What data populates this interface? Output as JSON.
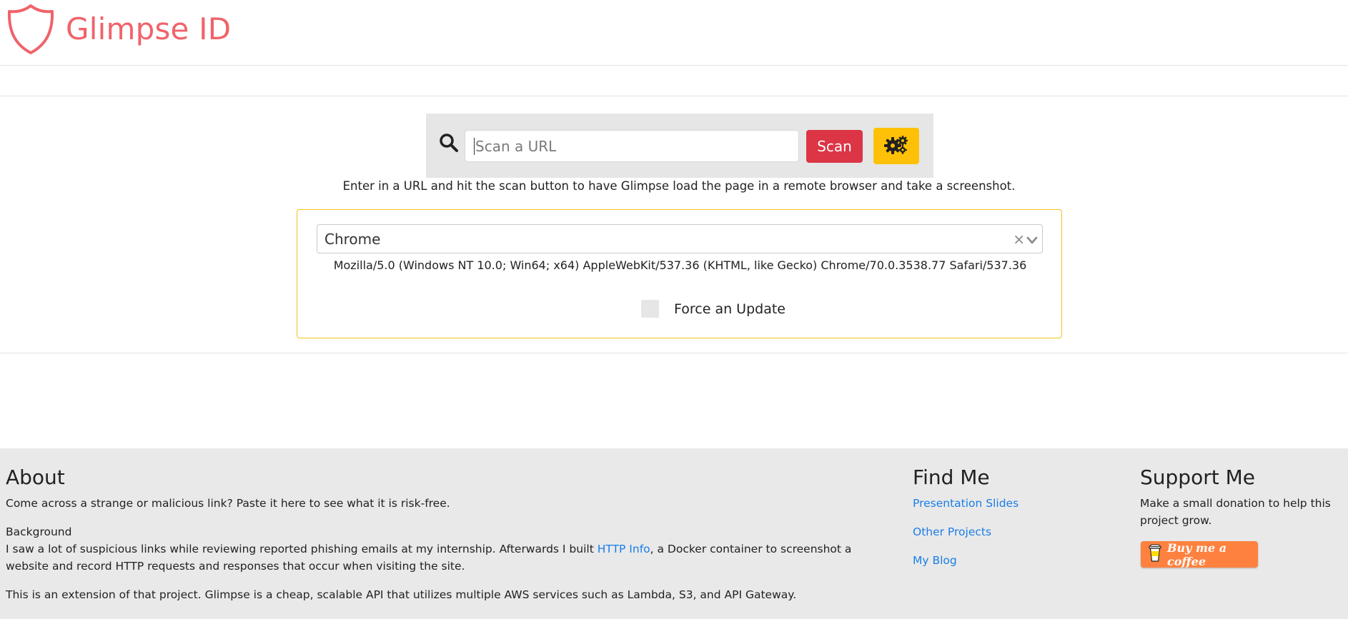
{
  "brand": {
    "name": "Glimpse ID",
    "color": "#f0636a"
  },
  "search": {
    "placeholder": "Scan a URL",
    "scan_label": "Scan",
    "helper": "Enter in a URL and hit the scan button to have Glimpse load the page in a remote browser and take a screenshot."
  },
  "options": {
    "browser_selected": "Chrome",
    "clear_symbol": "×",
    "user_agent": "Mozilla/5.0 (Windows NT 10.0; Win64; x64) AppleWebKit/537.36 (KHTML, like Gecko) Chrome/70.0.3538.77 Safari/537.36",
    "force_update_label": "Force an Update",
    "force_update_checked": false
  },
  "footer": {
    "about": {
      "title": "About",
      "intro": "Come across a strange or malicious link? Paste it here to see what it is risk-free.",
      "background_heading": "Background",
      "background_pre": "I saw a lot of suspicious links while reviewing reported phishing emails at my internship. Afterwards I built ",
      "background_link": "HTTP Info",
      "background_post": ", a Docker container to screenshot a website and record HTTP requests and responses that occur when visiting the site.",
      "extension": "This is an extension of that project. Glimpse is a cheap, scalable API that utilizes multiple AWS services such as Lambda, S3, and API Gateway."
    },
    "find_me": {
      "title": "Find Me",
      "links": [
        "Presentation Slides",
        "Other Projects",
        "My Blog"
      ]
    },
    "support": {
      "title": "Support Me",
      "text": "Make a small donation to help this project grow.",
      "button": "Buy me a coffee"
    }
  },
  "colors": {
    "scan_button": "#dc3545",
    "settings_button": "#ffc107",
    "link": "#1a7ee8",
    "coffee_button": "#ff813f",
    "footer_bg": "#e9e9e9"
  }
}
